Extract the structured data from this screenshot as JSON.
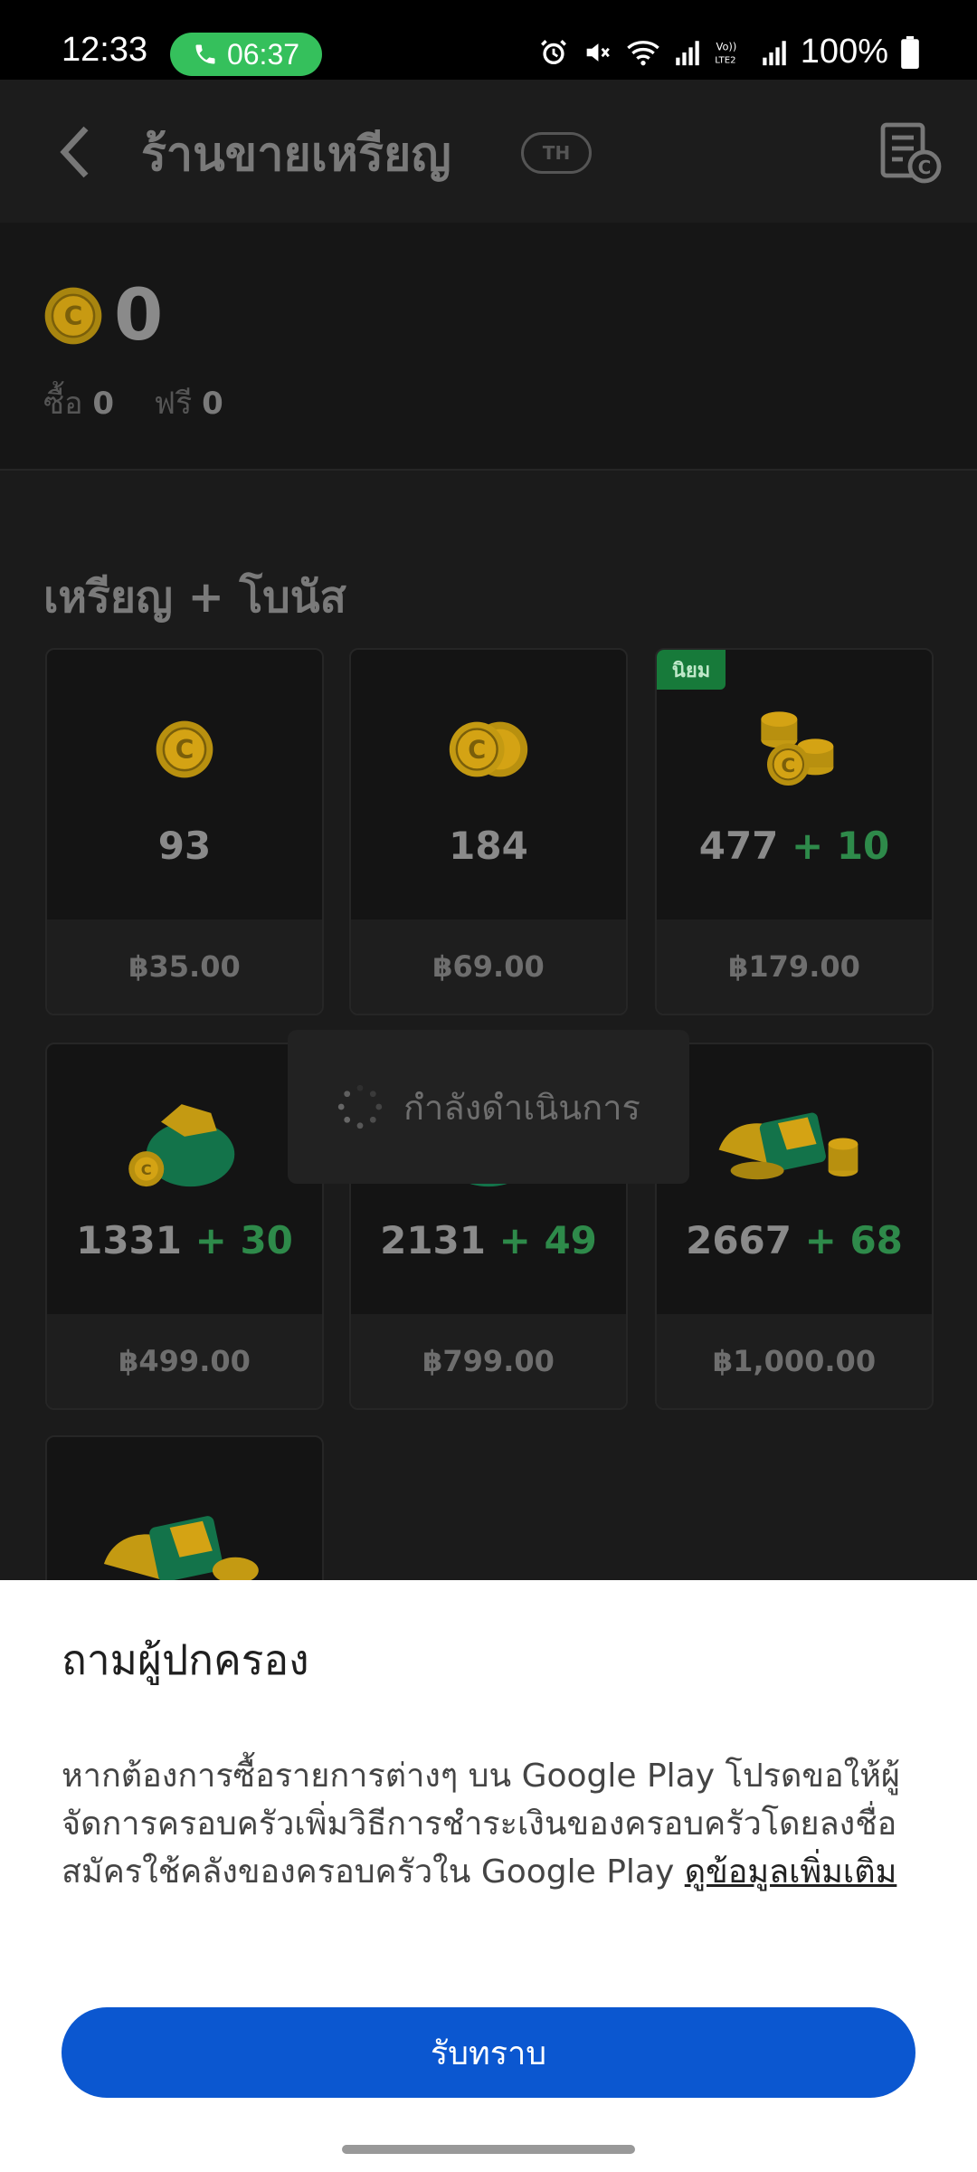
{
  "status_bar": {
    "time": "12:33",
    "call_timer": "06:37",
    "battery": "100%",
    "icons": [
      "alarm-icon",
      "mute-icon",
      "wifi-icon",
      "signal-icon",
      "volte-icon",
      "signal-icon-2",
      "battery-icon"
    ]
  },
  "header": {
    "title": "ร้านขายเหรียญ",
    "region": "TH",
    "back_icon": "arrow-left-icon",
    "history_icon": "coin-history-icon"
  },
  "balance": {
    "total": "0",
    "purchased_label": "ซื้อ",
    "purchased_value": "0",
    "free_label": "ฟรี",
    "free_value": "0"
  },
  "section": {
    "title": "เหรียญ + โบนัส"
  },
  "products": [
    {
      "amount": "93",
      "bonus": "",
      "price": "฿35.00"
    },
    {
      "amount": "184",
      "bonus": "",
      "price": "฿69.00"
    },
    {
      "amount": "477",
      "bonus": "+ 10",
      "price": "฿179.00",
      "badge": "นิยม"
    },
    {
      "amount": "1331",
      "bonus": "+ 30",
      "price": "฿499.00"
    },
    {
      "amount": "2131",
      "bonus": "+ 49",
      "price": "฿799.00"
    },
    {
      "amount": "2667",
      "bonus": "+ 68",
      "price": "฿1,000.00"
    }
  ],
  "loading": {
    "text": "กำลังดำเนินการ"
  },
  "sheet": {
    "title": "ถามผู้ปกครอง",
    "body": "หากต้องการซื้อรายการต่างๆ บน Google Play โปรดขอให้ผู้จัดการครอบครัวเพิ่มวิธีการชำระเงินของครอบครัวโดยลงชื่อสมัครใช้คลังของครอบครัวใน Google Play ",
    "link": "ดูข้อมูลเพิ่มเติม",
    "button": "รับทราบ"
  },
  "colors": {
    "accent_blue": "#0b57d0",
    "bonus_green": "#2e8a4a",
    "coin_gold": "#e0b21a",
    "call_green": "#35c05c"
  }
}
